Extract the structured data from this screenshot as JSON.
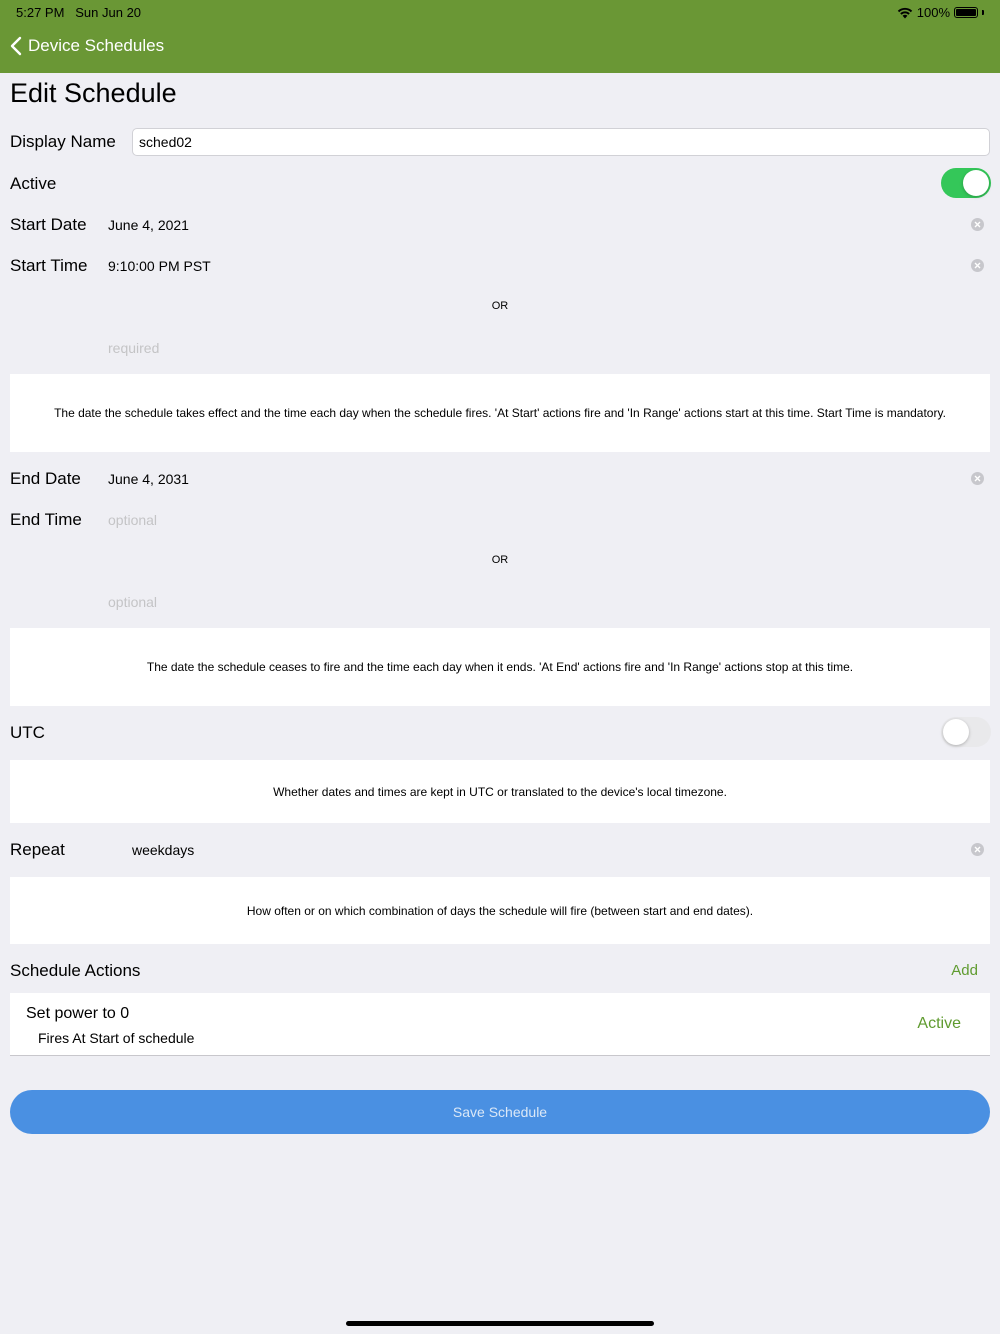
{
  "status_bar": {
    "time": "5:27 PM",
    "date": "Sun Jun 20",
    "battery": "100%"
  },
  "nav": {
    "back_label": "Device Schedules"
  },
  "page": {
    "title": "Edit Schedule"
  },
  "form": {
    "display_name": {
      "label": "Display Name",
      "value": "sched02"
    },
    "active": {
      "label": "Active",
      "on": true
    },
    "start_date": {
      "label": "Start Date",
      "value": "June 4, 2021"
    },
    "start_time": {
      "label": "Start Time",
      "value": "9:10:00 PM PST"
    },
    "start_or": "OR",
    "start_alt_placeholder": "required",
    "start_help": "The date the schedule takes effect and the time each day when the schedule fires. 'At Start' actions fire and 'In Range' actions start at this time.  Start Time is mandatory.",
    "end_date": {
      "label": "End Date",
      "value": "June 4, 2031"
    },
    "end_time": {
      "label": "End Time",
      "placeholder": "optional"
    },
    "end_or": "OR",
    "end_alt_placeholder": "optional",
    "end_help": "The date the schedule ceases to fire and the time each day when it ends. 'At End' actions fire and 'In Range' actions stop at this time.",
    "utc": {
      "label": "UTC",
      "on": false
    },
    "utc_help": "Whether dates and times are kept in UTC or translated to the device's local timezone.",
    "repeat": {
      "label": "Repeat",
      "value": "weekdays"
    },
    "repeat_help": "How often or on which combination of days the schedule will fire (between start and end dates)."
  },
  "actions": {
    "title": "Schedule Actions",
    "add_label": "Add",
    "items": [
      {
        "title": "Set power to 0",
        "subtitle": "Fires At Start of schedule",
        "status": "Active"
      }
    ]
  },
  "save_label": "Save Schedule",
  "colors": {
    "nav_bar": "#6a9735",
    "accent_green": "#5f9b2f",
    "toggle_on": "#34c759",
    "save_button": "#4a90e2"
  }
}
